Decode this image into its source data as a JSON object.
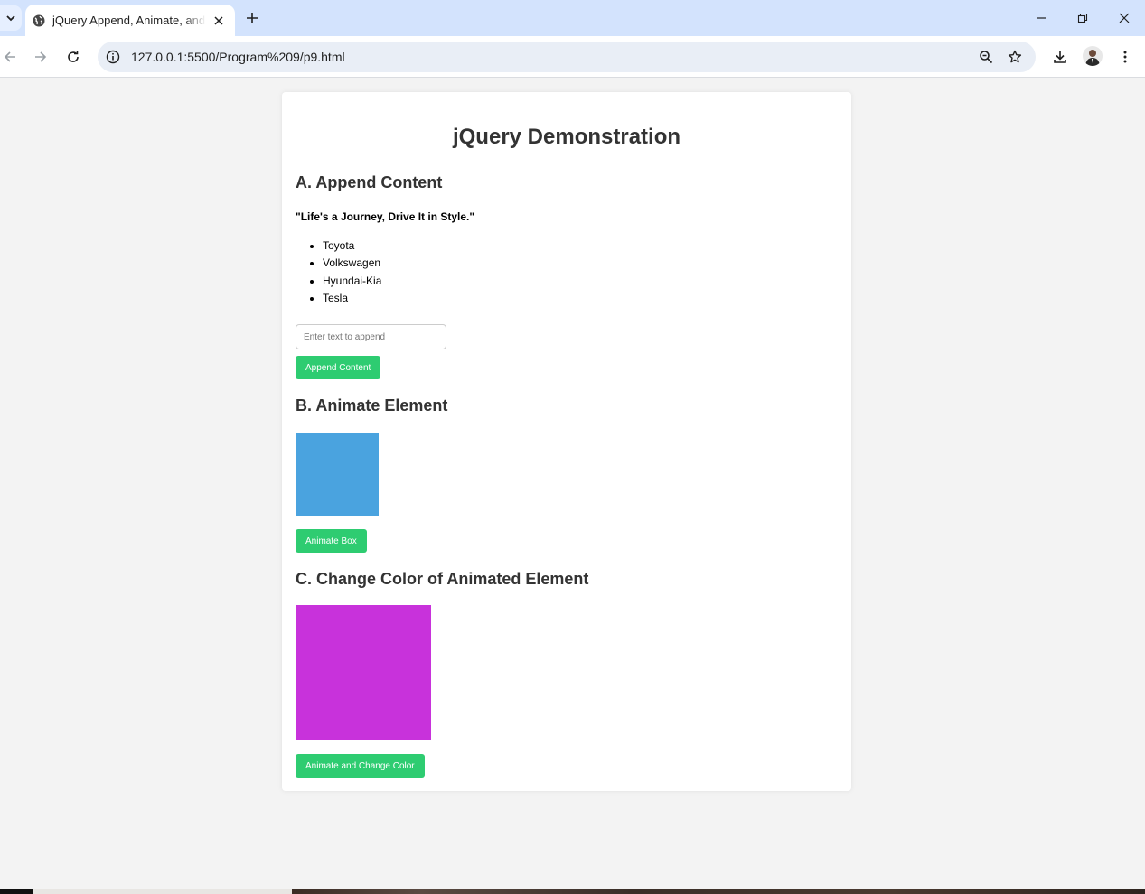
{
  "browser": {
    "tab_title": "jQuery Append, Animate, and Change Color",
    "url": "127.0.0.1:5500/Program%209/p9.html"
  },
  "page": {
    "title": "jQuery Demonstration",
    "section_a": {
      "heading": "A. Append Content",
      "quote": "\"Life's a Journey, Drive It in Style.\"",
      "items": [
        "Toyota",
        "Volkswagen",
        "Hyundai-Kia",
        "Tesla"
      ],
      "input_placeholder": "Enter text to append",
      "input_value": "",
      "button_label": "Append Content"
    },
    "section_b": {
      "heading": "B. Animate Element",
      "box_color": "#4aa3df",
      "button_label": "Animate Box"
    },
    "section_c": {
      "heading": "C. Change Color of Animated Element",
      "box_color": "#c832db",
      "button_label": "Animate and Change Color"
    }
  },
  "colors": {
    "button_green": "#2ecc71",
    "heading_text": "#333333",
    "page_background": "#f3f3f3",
    "tabstrip": "#d3e3fd"
  }
}
